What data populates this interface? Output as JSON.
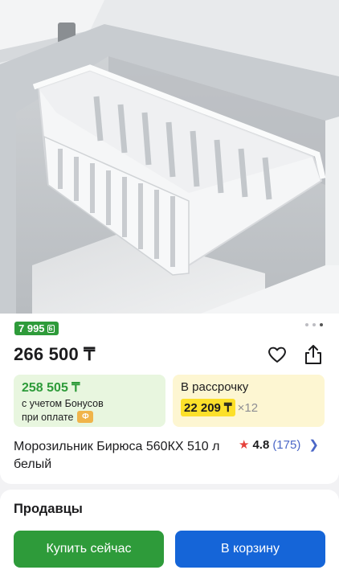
{
  "product": {
    "title": "Морозильник Бирюса 560КХ 510 л белый",
    "price": "266 500 ₸",
    "bonus_badge": "7 995",
    "rating": "4.8",
    "reviews_count": "(175)"
  },
  "payment_options": {
    "bonus_price": "258 505 ₸",
    "bonus_note_line1": "с учетом Бонусов",
    "bonus_note_line2": "при оплате",
    "installment_label": "В рассрочку",
    "installment_amount": "22 209 ₸",
    "installment_months": "×12"
  },
  "gallery": {
    "total_images": 3,
    "active_index": 2
  },
  "sellers": {
    "heading": "Продавцы",
    "buy_now_label": "Купить сейчас",
    "add_to_cart_label": "В корзину"
  },
  "colors": {
    "green": "#2e9b3a",
    "blue": "#1565d8",
    "yellow_highlight": "#fce02a",
    "rating_star": "#e5403a",
    "link_blue": "#4b67c7"
  },
  "icons": [
    "heart-icon",
    "share-icon",
    "star-icon",
    "chevron-right-icon",
    "bonus-coin-icon"
  ]
}
